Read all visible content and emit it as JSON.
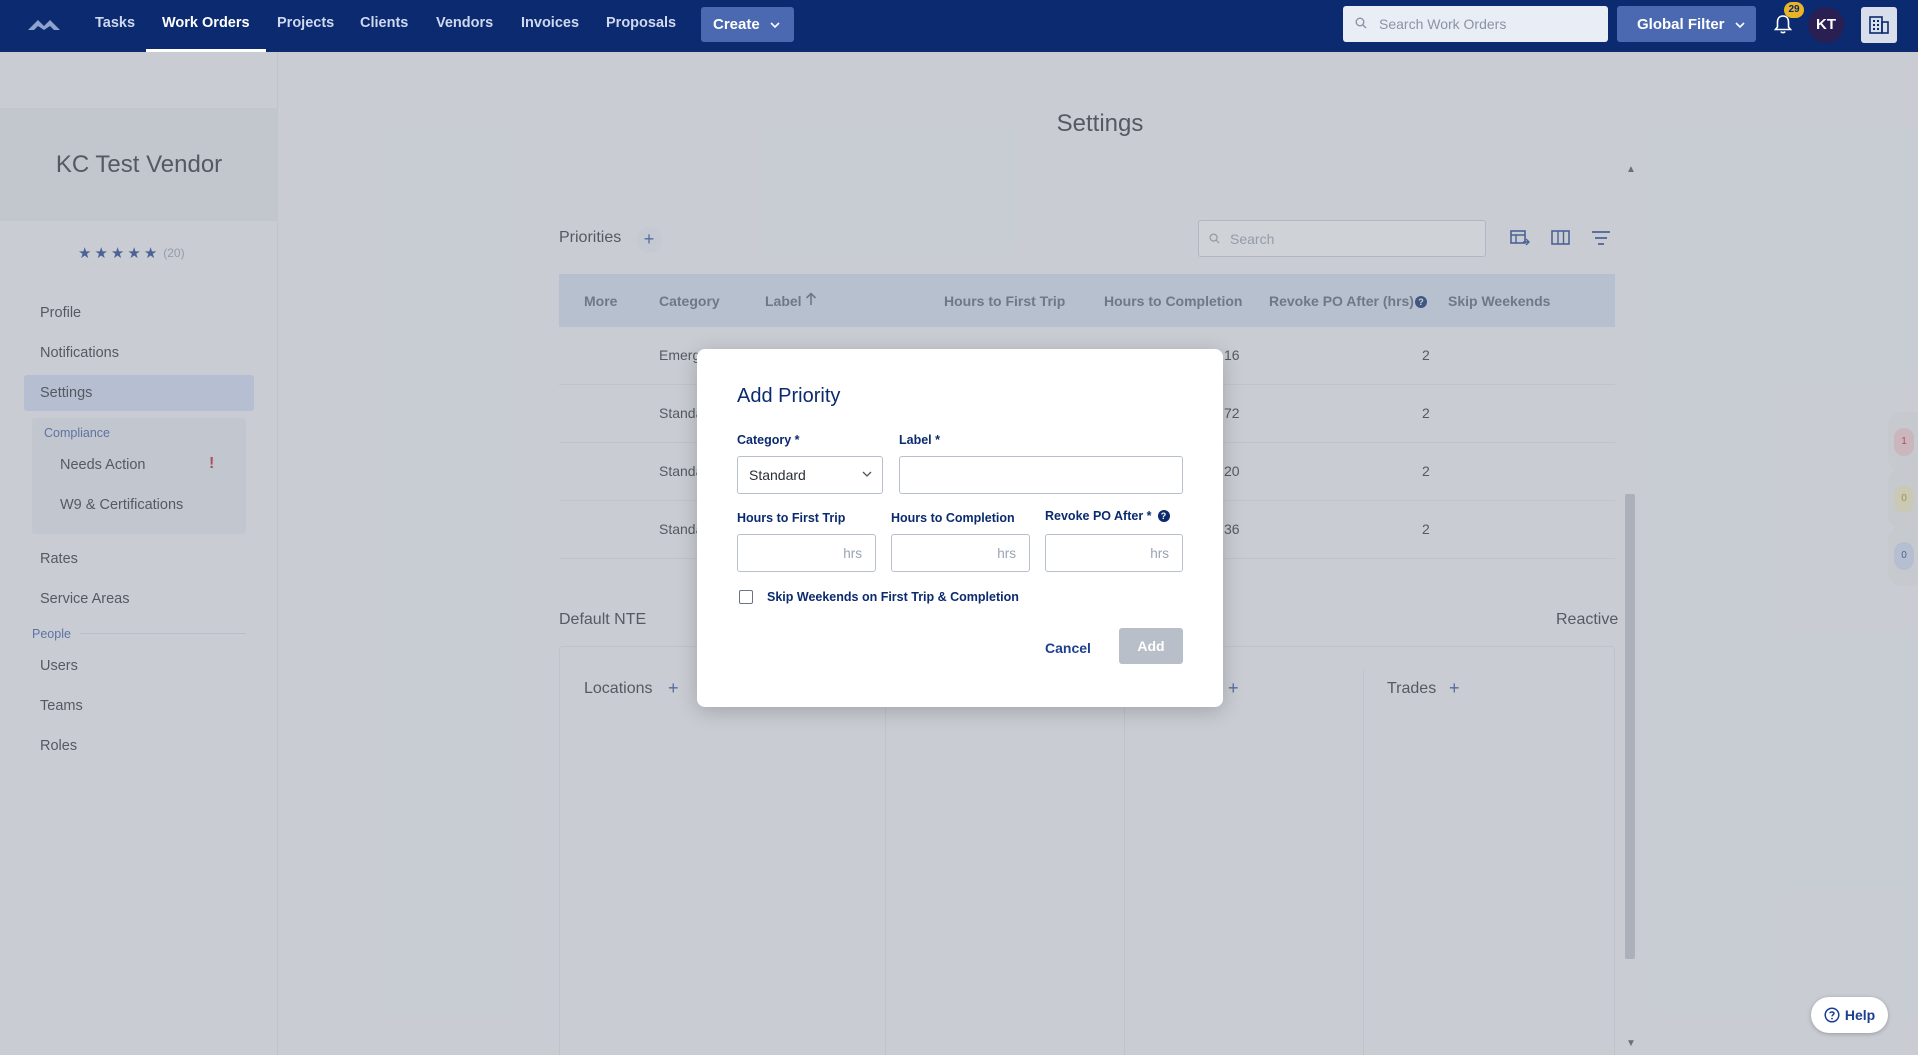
{
  "nav": {
    "items": [
      "Tasks",
      "Work Orders",
      "Projects",
      "Clients",
      "Vendors",
      "Invoices",
      "Proposals"
    ],
    "create_label": "Create",
    "search_placeholder": "Search Work Orders",
    "global_filter_label": "Global Filter",
    "notification_count": "29",
    "avatar_initials": "KT"
  },
  "sidebar": {
    "vendor_name": "KC Test Vendor",
    "rating_count": "(20)",
    "items": [
      "Profile",
      "Notifications",
      "Settings"
    ],
    "compliance_heading": "Compliance",
    "compliance_items": [
      "Needs Action",
      "W9 & Certifications"
    ],
    "items_after": [
      "Rates",
      "Service Areas"
    ],
    "people_heading": "People",
    "people_items": [
      "Users",
      "Teams",
      "Roles"
    ]
  },
  "main": {
    "page_title": "Settings",
    "priorities_title": "Priorities",
    "search_placeholder": "Search",
    "columns": [
      "More",
      "Category",
      "Label",
      "Hours to First Trip",
      "Hours to Completion",
      "Revoke PO After (hrs)",
      "Skip Weekends"
    ],
    "rows": [
      {
        "category": "Emerg",
        "completion": "16",
        "revoke": "2"
      },
      {
        "category": "Standa",
        "completion": "72",
        "revoke": "2"
      },
      {
        "category": "Standa",
        "completion": "20",
        "revoke": "2"
      },
      {
        "category": "Standa",
        "completion": "36",
        "revoke": "2"
      }
    ],
    "default_nte_title": "Default NTE",
    "reactive_label": "Reactive",
    "locations_title": "Locations",
    "trades_title": "Trades"
  },
  "side_tabs": [
    "1",
    "0",
    "0"
  ],
  "help_label": "Help",
  "modal": {
    "title": "Add Priority",
    "category_label": "Category *",
    "category_value": "Standard",
    "label_label": "Label *",
    "label_value": "",
    "first_trip_label": "Hours to First Trip",
    "completion_label": "Hours to Completion",
    "revoke_label": "Revoke PO After *",
    "hrs_suffix": "hrs",
    "skip_weekends_label": "Skip Weekends on First Trip & Completion",
    "cancel_label": "Cancel",
    "add_label": "Add"
  },
  "colors": {
    "nav_bg": "#0b2a6f",
    "accent": "#4a69b0",
    "table_header": "#d6e0f2",
    "alert": "#c0232c"
  }
}
